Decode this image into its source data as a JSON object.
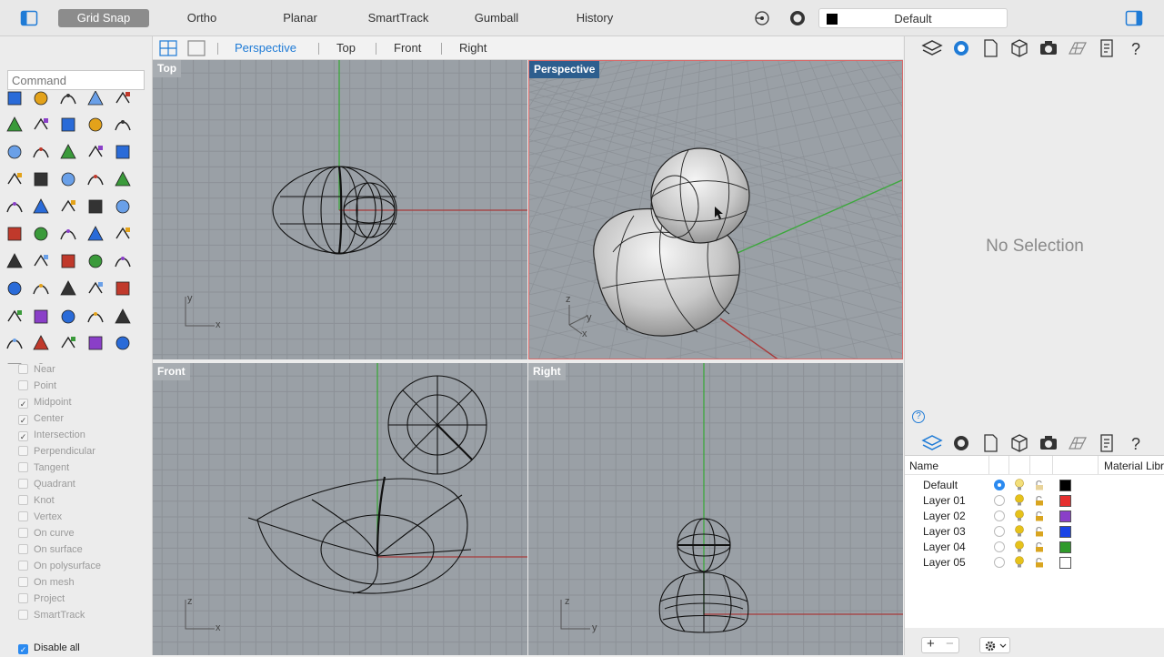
{
  "topbar": {
    "buttons": [
      {
        "label": "Grid Snap",
        "active": true
      },
      {
        "label": "Ortho"
      },
      {
        "label": "Planar"
      },
      {
        "label": "SmartTrack"
      },
      {
        "label": "Gumball"
      },
      {
        "label": "History"
      }
    ],
    "view_name": "Default"
  },
  "tabs": {
    "items": [
      "Perspective",
      "Top",
      "Front",
      "Right"
    ],
    "active": "Perspective"
  },
  "command": {
    "placeholder": "Command"
  },
  "snaps": [
    {
      "label": "Near",
      "checked": false
    },
    {
      "label": "Point",
      "checked": false
    },
    {
      "label": "Midpoint",
      "checked": true
    },
    {
      "label": "Center",
      "checked": true
    },
    {
      "label": "Intersection",
      "checked": true
    },
    {
      "label": "Perpendicular",
      "checked": false
    },
    {
      "label": "Tangent",
      "checked": false
    },
    {
      "label": "Quadrant",
      "checked": false
    },
    {
      "label": "Knot",
      "checked": false
    },
    {
      "label": "Vertex",
      "checked": false
    },
    {
      "label": "On curve",
      "checked": false
    },
    {
      "label": "On surface",
      "checked": false
    },
    {
      "label": "On polysurface",
      "checked": false
    },
    {
      "label": "On mesh",
      "checked": false
    },
    {
      "label": "Project",
      "checked": false
    },
    {
      "label": "SmartTrack",
      "checked": false
    }
  ],
  "disable_all": {
    "label": "Disable all",
    "checked": true
  },
  "viewports": {
    "top": "Top",
    "perspective": "Perspective",
    "front": "Front",
    "right": "Right"
  },
  "axis": {
    "x": "x",
    "y": "y",
    "z": "z"
  },
  "properties": {
    "empty_text": "No Selection",
    "help": "?"
  },
  "layers": {
    "header_name": "Name",
    "header_material": "Material Libr",
    "rows": [
      {
        "name": "Default",
        "current": true,
        "color": "#000000"
      },
      {
        "name": "Layer 01",
        "current": false,
        "color": "#e53030"
      },
      {
        "name": "Layer 02",
        "current": false,
        "color": "#8a3fc8"
      },
      {
        "name": "Layer 03",
        "current": false,
        "color": "#1a44e6"
      },
      {
        "name": "Layer 04",
        "current": false,
        "color": "#2f9a2a"
      },
      {
        "name": "Layer 05",
        "current": false,
        "color": "#ffffff"
      }
    ]
  },
  "colors": {
    "accent": "#1f7bd6",
    "grid_bg": "#9aa0a6",
    "x_axis": "#a83a3a",
    "y_axis": "#3ca83c"
  }
}
